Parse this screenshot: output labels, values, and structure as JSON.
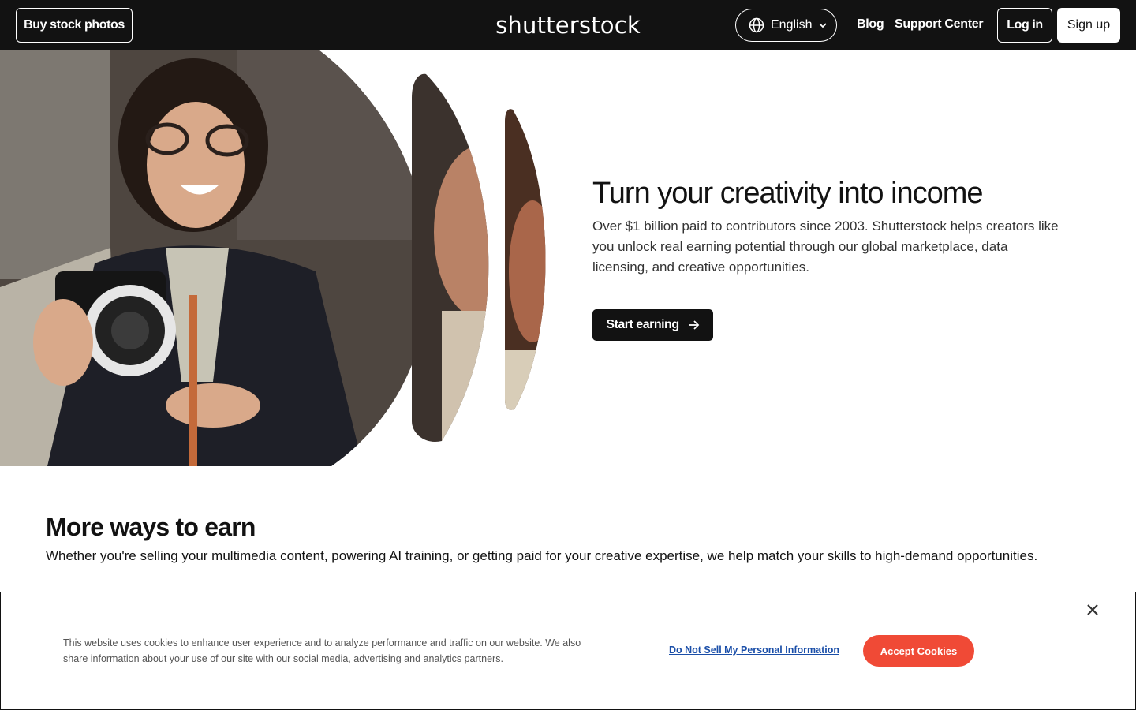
{
  "header": {
    "buy_label": "Buy stock photos",
    "logo": "shutterstock",
    "language": "English",
    "blog": "Blog",
    "support": "Support Center",
    "login": "Log in",
    "signup": "Sign up"
  },
  "hero": {
    "title": "Turn your creativity into income",
    "text": "Over $1 billion paid to contributors since 2003. Shutterstock helps creators like you unlock real earning potential through our global marketplace, data licensing, and creative opportunities.",
    "cta": "Start earning"
  },
  "more": {
    "title": "More ways to earn",
    "text": "Whether you're selling your multimedia content, powering AI training, or getting paid for your creative expertise, we help match your skills to high-demand opportunities."
  },
  "cookie": {
    "text": "This website uses cookies to enhance user experience and to analyze performance and traffic on our website. We also share information about your use of our site with our social media, advertising and analytics partners.",
    "dns": "Do Not Sell My Personal Information",
    "accept": "Accept Cookies"
  },
  "icons": {
    "globe": "globe-icon",
    "chevron": "chevron-down-icon",
    "arrow": "arrow-right-icon",
    "close": "close-icon"
  },
  "colors": {
    "nav_bg": "#121212",
    "accent_red": "#f04a36",
    "link_blue": "#1a4ea8"
  }
}
